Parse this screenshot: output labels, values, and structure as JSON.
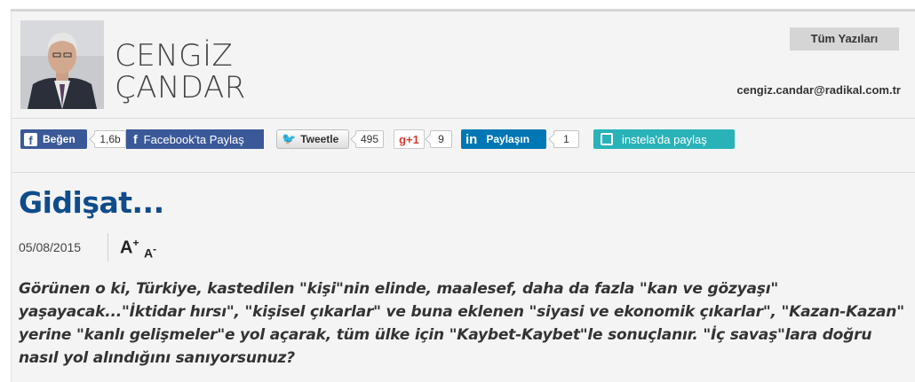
{
  "author": {
    "first_name": "CENGİZ",
    "last_name": "ÇANDAR",
    "email": "cengiz.candar@radikal.com.tr",
    "all_posts_label": "Tüm Yazıları"
  },
  "share": {
    "fb_like_label": "Beğen",
    "fb_like_count": "1,6b",
    "fb_share_label": "Facebook'ta Paylaş",
    "tweet_label": "Tweetle",
    "tweet_count": "495",
    "gplus_label": "g+1",
    "gplus_count": "9",
    "linkedin_label": "Paylaşın",
    "linkedin_count": "1",
    "instela_label": "instela'da paylaş"
  },
  "article": {
    "title": "Gidişat...",
    "date": "05/08/2015",
    "font_increase": "A",
    "font_increase_sign": "+",
    "font_decrease": "A",
    "font_decrease_sign": "-",
    "lead": "Görünen o ki, Türkiye, kastedilen \"kişi\"nin elinde, maalesef, daha da fazla \"kan ve gözyaşı\" yaşayacak...\"İktidar hırsı\", \"kişisel çıkarlar\" ve buna eklenen \"siyasi ve ekonomik çıkarlar\", \"Kazan-Kazan\" yerine \"kanlı gelişmeler\"e yol açarak, tüm ülke için \"Kaybet-Kaybet\"le sonuçlanır. \"İç savaş\"lara doğru nasıl yol alındığını sanıyorsunuz?"
  },
  "colors": {
    "title_blue": "#0f4c8a",
    "facebook": "#3b5998",
    "linkedin": "#0077b5",
    "instela": "#29b3b8"
  }
}
